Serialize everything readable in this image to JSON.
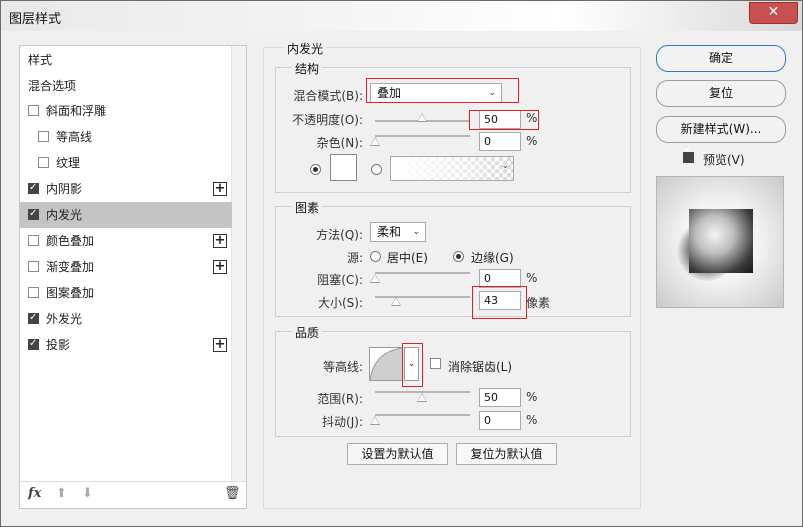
{
  "window": {
    "title": "图层样式",
    "close_icon": "✕"
  },
  "left_panel": {
    "items": [
      {
        "label": "样式"
      },
      {
        "label": "混合选项"
      },
      {
        "label": "斜面和浮雕",
        "checked": false
      },
      {
        "label": "等高线",
        "checked": false
      },
      {
        "label": "纹理",
        "checked": false
      },
      {
        "label": "内阴影",
        "checked": true
      },
      {
        "label": "内发光",
        "checked": true,
        "selected": true
      },
      {
        "label": "颜色叠加",
        "checked": false
      },
      {
        "label": "渐变叠加",
        "checked": false
      },
      {
        "label": "图案叠加",
        "checked": false
      },
      {
        "label": "外发光",
        "checked": true
      },
      {
        "label": "投影",
        "checked": true
      }
    ],
    "bottom": {
      "fx": "fx",
      "up": "⬆",
      "down": "⬇",
      "trash": "🗑"
    }
  },
  "panel": {
    "title": "内发光",
    "structure": {
      "legend": "结构",
      "blend_label": "混合模式(B):",
      "blend_value": "叠加",
      "opacity_label": "不透明度(O):",
      "opacity_value": "50",
      "opacity_unit": "%",
      "noise_label": "杂色(N):",
      "noise_value": "0",
      "noise_unit": "%"
    },
    "elements": {
      "legend": "图素",
      "method_label": "方法(Q):",
      "method_value": "柔和",
      "source_label": "源:",
      "source_center": "居中(E)",
      "source_edge": "边缘(G)",
      "choke_label": "阻塞(C):",
      "choke_value": "0",
      "choke_unit": "%",
      "size_label": "大小(S):",
      "size_value": "43",
      "size_unit": "像素"
    },
    "quality": {
      "legend": "品质",
      "contour_label": "等高线:",
      "antialias_label": "消除锯齿(L)",
      "range_label": "范围(R):",
      "range_value": "50",
      "range_unit": "%",
      "jitter_label": "抖动(J):",
      "jitter_value": "0",
      "jitter_unit": "%"
    },
    "set_default": "设置为默认值",
    "reset_default": "复位为默认值"
  },
  "right": {
    "ok": "确定",
    "reset": "复位",
    "new_style": "新建样式(W)...",
    "preview_label": "预览(V)",
    "preview_checked": true
  },
  "colors": {
    "highlight": "#e0202a",
    "selected_row": "#c4c4c4",
    "primary_border": "#2f7ad1"
  }
}
